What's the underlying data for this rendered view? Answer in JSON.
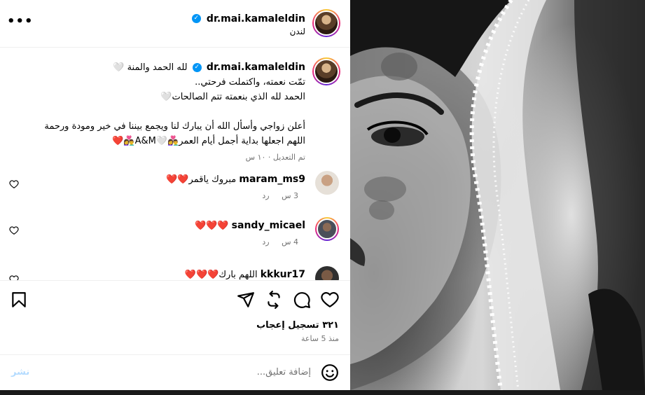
{
  "post": {
    "author": "dr.mai.kamaleldin",
    "location": "لندن",
    "menu_icon": "more-horizontal-icon"
  },
  "caption": {
    "username": "dr.mai.kamaleldin",
    "line1": "لله الحمد والمنة 🤍",
    "line2": "تمّت نعمته، واكتملت فرحتي..",
    "line3": "الحمد لله الذي بنعمته تتم الصالحات🤍",
    "line4": "أعلن زواجي وأسأل الله أن يبارك لنا ويجمع بيننا في خير ومودة ورحمة",
    "line5": "اللهم اجعلها بداية أجمل أيام العمر👩‍❤️‍👨🤍A&M👩‍❤️‍👨❤️",
    "edited": "تم التعديل · ١٠ س"
  },
  "comments": [
    {
      "username": "maram_ms9",
      "text": "مبروك ياقمر❤️❤️",
      "age": "3 س",
      "reply": "رد"
    },
    {
      "username": "sandy_micael",
      "text": "❤️❤️❤️",
      "age": "4 س",
      "reply": "رد"
    },
    {
      "username": "kkkur17",
      "text": "اللهم بارك❤️❤️❤️",
      "age": "",
      "reply": ""
    }
  ],
  "stats": {
    "likes": "٣٢١ تسجيل إعجاب",
    "time": "منذ 5 ساعة"
  },
  "compose": {
    "placeholder": "إضافة تعليق...",
    "post_label": "نشر"
  },
  "colors": {
    "verified": "#0095f6",
    "post_button_disabled": "#b3dbff",
    "heart_red": "#e0162b"
  }
}
